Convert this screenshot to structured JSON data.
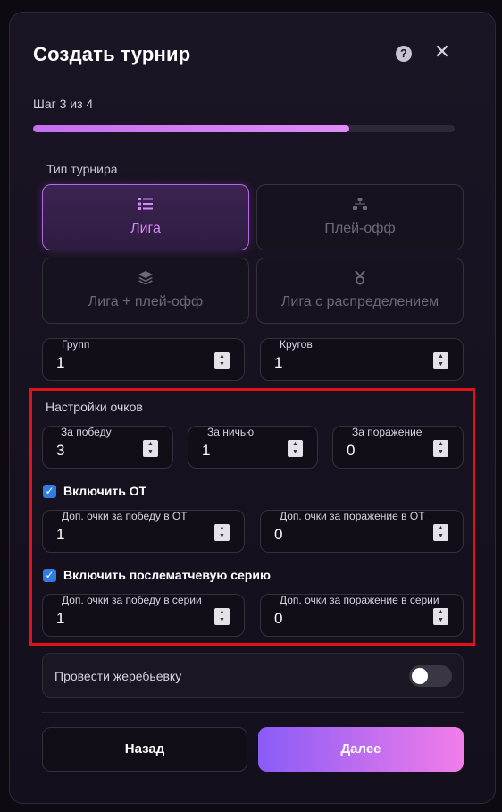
{
  "modal": {
    "title": "Создать турнир",
    "help_icon": "?",
    "close_icon": "✕",
    "step_text": "Шаг 3 из 4",
    "progress_fraction": 0.75
  },
  "tournament_type": {
    "label": "Тип турнира",
    "options": [
      {
        "label": "Лига",
        "icon": "list-icon",
        "active": true
      },
      {
        "label": "Плей-офф",
        "icon": "bracket-icon",
        "active": false
      },
      {
        "label": "Лига + плей-офф",
        "icon": "layers-icon",
        "active": false
      },
      {
        "label": "Лига с распределением",
        "icon": "medal-icon",
        "active": false
      }
    ]
  },
  "groups_field": {
    "label": "Групп",
    "value": "1"
  },
  "rounds_field": {
    "label": "Кругов",
    "value": "1"
  },
  "points": {
    "title": "Настройки очков",
    "win": {
      "label": "За победу",
      "value": "3"
    },
    "draw": {
      "label": "За ничью",
      "value": "1"
    },
    "loss": {
      "label": "За поражение",
      "value": "0"
    },
    "ot": {
      "checkbox_label": "Включить ОТ",
      "checked": true,
      "win": {
        "label": "Доп. очки за победу в ОТ",
        "value": "1"
      },
      "loss": {
        "label": "Доп. очки за поражение в ОТ",
        "value": "0"
      }
    },
    "shootout": {
      "checkbox_label": "Включить послематчевую серию",
      "checked": true,
      "win": {
        "label": "Доп. очки за победу в серии",
        "value": "1"
      },
      "loss": {
        "label": "Доп. очки за поражение в серии",
        "value": "0"
      }
    }
  },
  "draw_toggle": {
    "label": "Провести жеребьевку",
    "on": false
  },
  "buttons": {
    "back": "Назад",
    "next": "Далее"
  },
  "colors": {
    "accent": "#b767e8",
    "highlight": "#e0121a",
    "checkbox": "#2f7de1"
  }
}
